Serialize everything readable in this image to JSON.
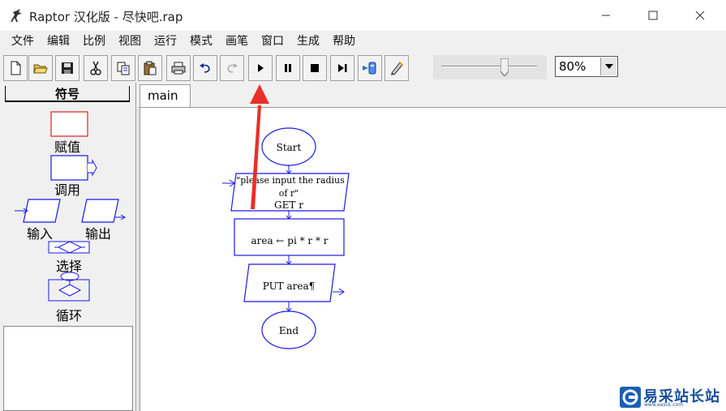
{
  "window": {
    "title": "Raptor 汉化版 - 尽快吧.rap"
  },
  "menu": [
    "文件",
    "编辑",
    "比例",
    "视图",
    "运行",
    "模式",
    "画笔",
    "窗口",
    "生成",
    "帮助"
  ],
  "toolbar": {
    "buttons": [
      "new",
      "open",
      "save",
      "cut",
      "copy",
      "paste",
      "print",
      "undo",
      "redo",
      "run",
      "pause",
      "stop",
      "step",
      "test-server",
      "pen"
    ],
    "zoom_value": "80%",
    "speed_slider_level": 0.66
  },
  "palette": {
    "header": "符号",
    "symbols": {
      "assignment": "赋值",
      "call": "调用",
      "input": "输入",
      "output": "输出",
      "selection": "选择",
      "loop": "循环"
    }
  },
  "tab": {
    "label": "main"
  },
  "flowchart": {
    "start": "Start",
    "input_prompt_line1": "\"please input the radius",
    "input_prompt_line2": "of r\"",
    "input_get": "GET r",
    "assignment": "area ← pi * r * r",
    "output": "PUT area¶",
    "end": "End"
  },
  "watermark": {
    "text": "易采站长站",
    "sub": "www.easck.com"
  },
  "colors": {
    "flow_blue": "#1a1ae6",
    "arrow_red": "#e8302a",
    "assign_red": "#e02020"
  }
}
